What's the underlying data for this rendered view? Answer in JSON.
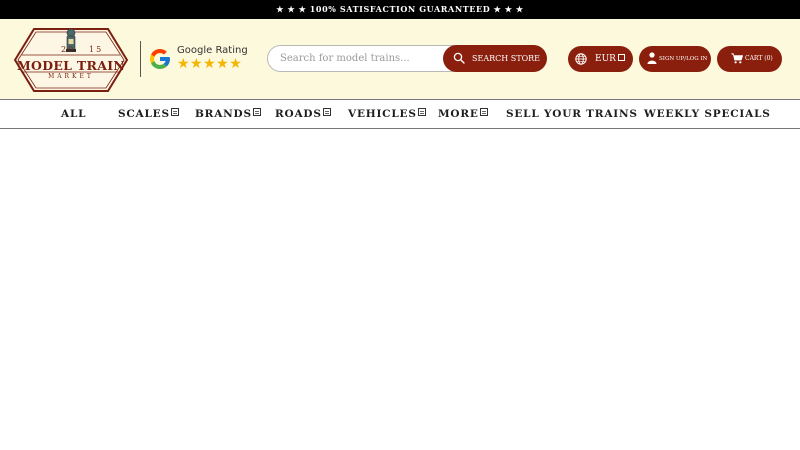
{
  "announcement": "★ ★ ★ 100% SATISFACTION GUARANTEED ★ ★ ★",
  "logo": {
    "year_left": "20",
    "year_right": "15",
    "name": "MODEL TRAIN",
    "subname": "MARKET"
  },
  "google_rating": {
    "label": "Google Rating",
    "stars": "★★★★★",
    "rating_out_of_5": 5
  },
  "search": {
    "placeholder": "Search for model trains...",
    "value": "",
    "button_label": "SEARCH STORE"
  },
  "currency": {
    "selected": "EUR"
  },
  "account": {
    "label": "SIGN UP/LOG IN"
  },
  "cart": {
    "label": "CART (0)"
  },
  "nav": {
    "items": [
      {
        "label": "ALL",
        "has_dropdown": false
      },
      {
        "label": "SCALES",
        "has_dropdown": true
      },
      {
        "label": "BRANDS",
        "has_dropdown": true
      },
      {
        "label": "ROADS",
        "has_dropdown": true
      },
      {
        "label": "VEHICLES",
        "has_dropdown": true
      },
      {
        "label": "MORE",
        "has_dropdown": true
      },
      {
        "label": "SELL YOUR TRAINS",
        "has_dropdown": false
      },
      {
        "label": "WEEKLY SPECIALS",
        "has_dropdown": false
      }
    ]
  },
  "colors": {
    "brand_red": "#8a1f0e",
    "header_bg": "#fdf9dd",
    "topbar_bg": "#000000",
    "star_gold": "#f4b400"
  },
  "icons": {
    "search": "search-icon",
    "currency": "globe-icon",
    "account": "user-icon",
    "cart": "cart-icon",
    "dropdown": "dropdown-icon"
  }
}
